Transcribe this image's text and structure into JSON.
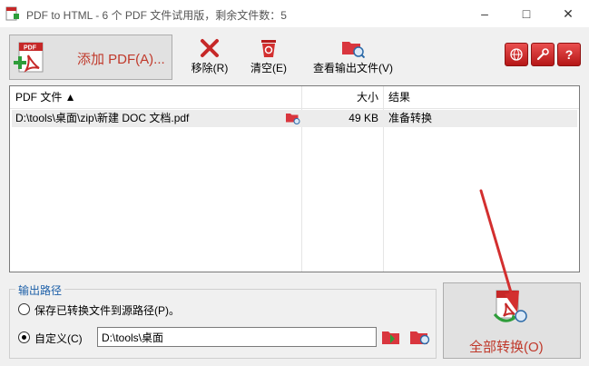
{
  "window": {
    "title": "PDF to HTML - 6 个 PDF 文件试用版，剩余文件数：5",
    "minimize": "–",
    "maximize": "□",
    "close": "✕"
  },
  "toolbar": {
    "add_pdf": "添加 PDF(A)...",
    "remove": "移除(R)",
    "clear": "清空(E)",
    "view_output": "查看输出文件(V)",
    "icons": [
      "web-icon",
      "settings-icon",
      "help-icon"
    ]
  },
  "file_list": {
    "columns": {
      "file": "PDF 文件 ▲",
      "size": "大小",
      "result": "结果"
    },
    "rows": [
      {
        "file": "D:\\tools\\桌面\\zip\\新建 DOC 文档.pdf",
        "size": "49 KB",
        "result": "准备转换"
      }
    ]
  },
  "output": {
    "legend": "输出路径",
    "option_source": "保存已转换文件到源路径(P)。",
    "option_custom": "自定义(C)",
    "selected": "custom",
    "path_value": "D:\\tools\\桌面"
  },
  "convert_all": "全部转换(O)",
  "colors": {
    "accent_red": "#c0392b",
    "legend_blue": "#1c5fa8",
    "row_highlight": "#ececec"
  }
}
